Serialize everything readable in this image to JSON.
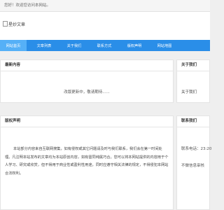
{
  "topbar": {
    "welcome": "您好！欢迎您访问本网站。"
  },
  "header": {
    "logo_alt": "星妙文章"
  },
  "nav": {
    "items": [
      {
        "label": "网站首页",
        "active": true
      },
      {
        "label": "文章列表",
        "active": false
      },
      {
        "label": "关于我们",
        "active": false
      },
      {
        "label": "联系方式",
        "active": false
      },
      {
        "label": "版权声明",
        "active": false
      },
      {
        "label": "网站地图",
        "active": false
      }
    ]
  },
  "latest": {
    "title": "最新内容",
    "message": "改版更新中，敬请期待......"
  },
  "about": {
    "title": "关于我们",
    "link": "关于我们"
  },
  "copyright": {
    "title": "版权声明",
    "text": "本站部分内容来自互联网搜集，如有侵权或其它问题请及时与我们联系，我们会在第一时间处理。凡注明本站发布的文章均为本站原创内容，如有雷同纯属巧合。您可以将本网站提供的内容用于个人学习、研究或欣赏，但不得用于商业性或盈利性用途，同时应遵守相关法律的规定，不得侵犯本网站合法权利。"
  },
  "contact": {
    "title": "联系我们",
    "time": "联系电话：23:20",
    "info": "不做信息审核"
  },
  "colors": {
    "nav_bg": "#2a8ee8",
    "nav_active": "#55b0f7"
  }
}
